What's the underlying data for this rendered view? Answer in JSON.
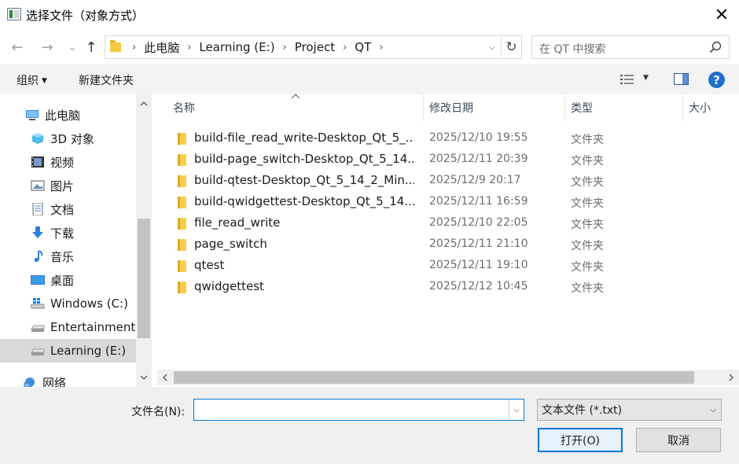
{
  "window": {
    "title": "选择文件（对象方式）",
    "close_glyph": "✕"
  },
  "nav": {
    "back_glyph": "←",
    "forward_glyph": "→",
    "recent_glyph": "⌄",
    "up_glyph": "↑"
  },
  "address": {
    "crumbs": [
      "此电脑",
      "Learning (E:)",
      "Project",
      "QT"
    ],
    "separator": "›",
    "dropdown_glyph": "⌵",
    "refresh_glyph": "↻"
  },
  "search": {
    "placeholder": "在 QT 中搜索"
  },
  "toolbar": {
    "organize_label": "组织",
    "organize_caret": "▼",
    "new_folder_label": "新建文件夹",
    "view_caret": "▼",
    "help_glyph": "?"
  },
  "sidebar": {
    "items": [
      {
        "label": "此电脑",
        "icon": "computer-icon"
      },
      {
        "label": "3D 对象",
        "icon": "3d-objects-icon"
      },
      {
        "label": "视频",
        "icon": "video-icon"
      },
      {
        "label": "图片",
        "icon": "pictures-icon"
      },
      {
        "label": "文档",
        "icon": "documents-icon"
      },
      {
        "label": "下载",
        "icon": "downloads-icon"
      },
      {
        "label": "音乐",
        "icon": "music-icon"
      },
      {
        "label": "桌面",
        "icon": "desktop-icon"
      },
      {
        "label": "Windows (C:)",
        "icon": "windows-drive-icon"
      },
      {
        "label": "Entertainment (",
        "icon": "drive-icon"
      },
      {
        "label": "Learning (E:)",
        "icon": "drive-icon",
        "selected": true
      },
      {
        "label": "网络",
        "icon": "network-icon"
      }
    ],
    "scroll_up": "^",
    "scroll_down": "v"
  },
  "filelist": {
    "columns": {
      "name": "名称",
      "modified": "修改日期",
      "type": "类型",
      "size": "大小"
    },
    "sort_glyph": "^",
    "rows": [
      {
        "name": "build-file_read_write-Desktop_Qt_5_...",
        "modified": "2025/12/10 19:55",
        "type": "文件夹"
      },
      {
        "name": "build-page_switch-Desktop_Qt_5_14...",
        "modified": "2025/12/11 20:39",
        "type": "文件夹"
      },
      {
        "name": "build-qtest-Desktop_Qt_5_14_2_Min...",
        "modified": "2025/12/9 20:17",
        "type": "文件夹"
      },
      {
        "name": "build-qwidgettest-Desktop_Qt_5_14...",
        "modified": "2025/12/11 16:59",
        "type": "文件夹"
      },
      {
        "name": "file_read_write",
        "modified": "2025/12/10 22:05",
        "type": "文件夹"
      },
      {
        "name": "page_switch",
        "modified": "2025/12/11 21:10",
        "type": "文件夹"
      },
      {
        "name": "qtest",
        "modified": "2025/12/11 19:10",
        "type": "文件夹"
      },
      {
        "name": "qwidgettest",
        "modified": "2025/12/12 10:45",
        "type": "文件夹"
      }
    ],
    "hscroll_left": "<",
    "hscroll_right": ">"
  },
  "bottom": {
    "filename_label": "文件名(N):",
    "filename_value": "",
    "filename_dd_glyph": "⌵",
    "filetype_value": "文本文件 (*.txt)",
    "filetype_caret": "⌵",
    "open_label": "打开(O)",
    "cancel_label": "取消"
  },
  "colors": {
    "accent": "#0078d7",
    "folder": "#f8cd50",
    "selected_nav": "#d9d9d9",
    "help": "#1f6fd1"
  }
}
